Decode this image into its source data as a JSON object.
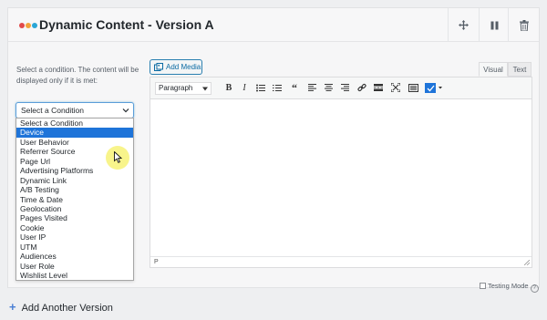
{
  "panel": {
    "title": "Dynamic Content - Version A",
    "logo_colors": [
      "#e14a4a",
      "#f2a33a",
      "#2aa6d6"
    ],
    "actions": [
      {
        "name": "move-icon"
      },
      {
        "name": "pause-icon"
      },
      {
        "name": "trash-icon"
      }
    ]
  },
  "condition": {
    "description": "Select a condition. The content will be displayed only if it is met:",
    "select_value": "Select a Condition",
    "options": [
      "Select a Condition",
      "Device",
      "User Behavior",
      "Referrer Source",
      "Page Url",
      "Advertising Platforms",
      "Dynamic Link",
      "A/B Testing",
      "Time & Date",
      "Geolocation",
      "Pages Visited",
      "Cookie",
      "User IP",
      "UTM",
      "Audiences",
      "User Role",
      "Wishlist Level"
    ],
    "highlighted_index": 1,
    "highlight_color": "#1e74d9"
  },
  "editor": {
    "add_media_label": "Add Media",
    "tab_visual": "Visual",
    "tab_text": "Text",
    "format_value": "Paragraph",
    "status_path": "P",
    "toolbar_icons": [
      "bold-icon",
      "italic-icon",
      "bullet-list-icon",
      "numbered-list-icon",
      "blockquote-icon",
      "align-left-icon",
      "align-center-icon",
      "align-right-icon",
      "link-icon",
      "read-more-icon",
      "fullscreen-icon",
      "toolbar-toggle-icon",
      "text-color-icon"
    ]
  },
  "testing_mode": {
    "label": "Testing Mode",
    "help": "?"
  },
  "footer": {
    "add_version_label": "Add Another Version",
    "accent": "#4a7fd4"
  }
}
